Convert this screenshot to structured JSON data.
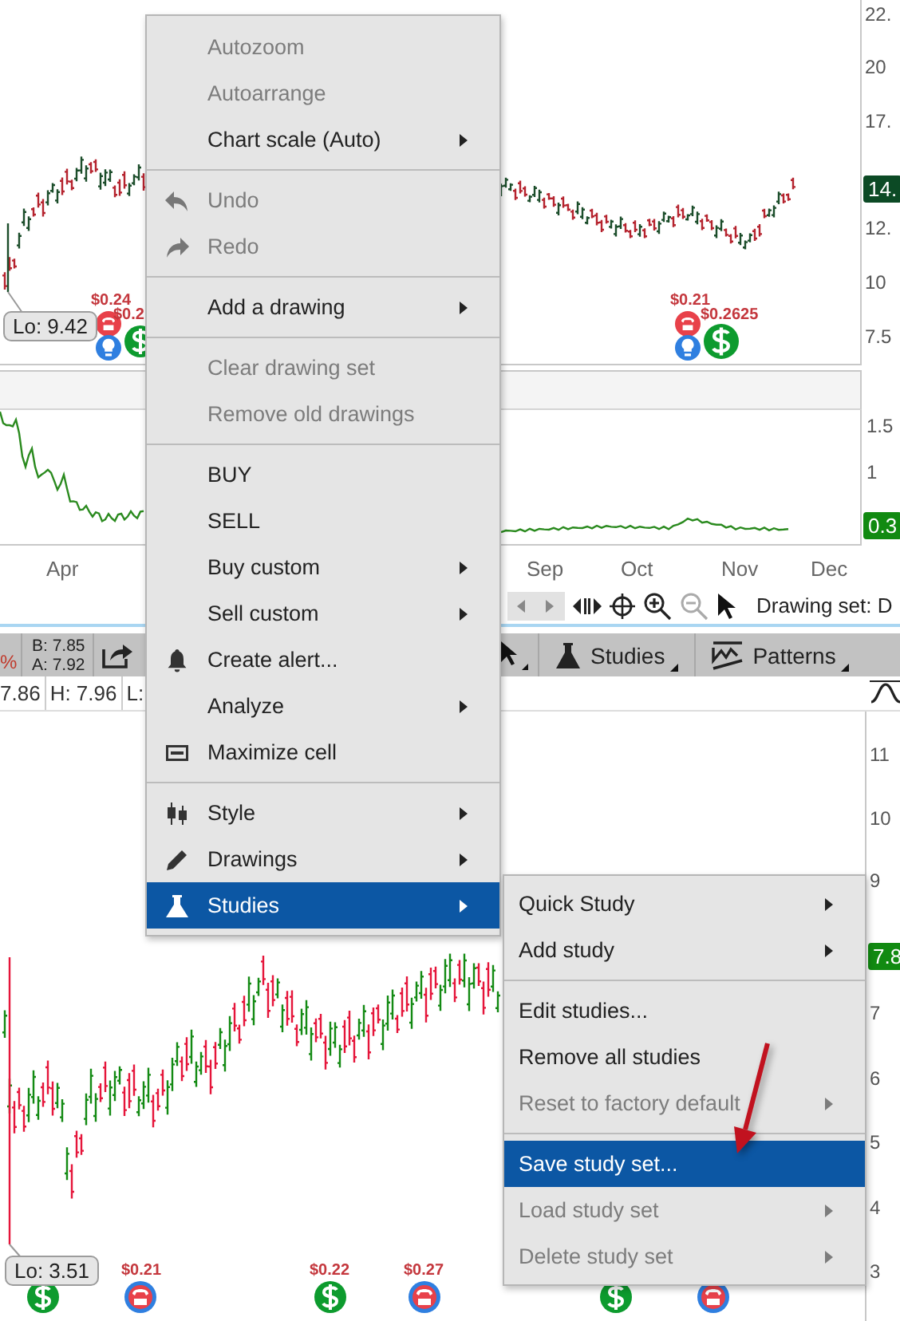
{
  "price_chart": {
    "axis_labels": [
      "22.",
      "20",
      "17.",
      "12.",
      "10",
      "7.5"
    ],
    "last_price": "14.",
    "low_label": "Lo: 9.42",
    "dividends": [
      "$0.24",
      "$0.2",
      "$0.21",
      "$0.2625"
    ]
  },
  "study_pane": {
    "axis_labels": [
      "1.5",
      "1"
    ],
    "last_value": "0.3"
  },
  "time_axis": [
    "Apr",
    "Sep",
    "Oct",
    "Nov",
    "Dec"
  ],
  "chart_toolbar": {
    "drawing_set": "Drawing set: D"
  },
  "cell_toolbar": {
    "change": "%",
    "bid": "B: 7.85",
    "ask": "A: 7.92",
    "buttons": [
      "Studies",
      "Patterns"
    ]
  },
  "quote_row": [
    "7.86",
    "H: 7.96",
    "L:"
  ],
  "lower_chart": {
    "axis_labels": [
      "11",
      "10",
      "9",
      "7",
      "6",
      "5",
      "4",
      "3"
    ],
    "last_price": "7.8",
    "low_label": "Lo: 3.51",
    "dividends": [
      "$0.21",
      "$0.22",
      "$0.27"
    ]
  },
  "context_menu": [
    {
      "kind": "item",
      "label": "Autozoom",
      "disabled": true,
      "selected": false,
      "submenu": false
    },
    {
      "kind": "item",
      "label": "Autoarrange",
      "disabled": true,
      "selected": false,
      "submenu": false
    },
    {
      "kind": "item",
      "label": "Chart scale (Auto)",
      "disabled": false,
      "selected": false,
      "submenu": true
    },
    {
      "kind": "separator"
    },
    {
      "kind": "item",
      "label": "Undo",
      "disabled": true,
      "selected": false,
      "submenu": false
    },
    {
      "kind": "item",
      "label": "Redo",
      "disabled": true,
      "selected": false,
      "submenu": false
    },
    {
      "kind": "separator"
    },
    {
      "kind": "item",
      "label": "Add a drawing",
      "disabled": false,
      "selected": false,
      "submenu": true
    },
    {
      "kind": "separator"
    },
    {
      "kind": "item",
      "label": "Clear drawing set",
      "disabled": true,
      "selected": false,
      "submenu": false
    },
    {
      "kind": "item",
      "label": "Remove old drawings",
      "disabled": true,
      "selected": false,
      "submenu": false
    },
    {
      "kind": "separator"
    },
    {
      "kind": "item",
      "label": "BUY",
      "disabled": false,
      "selected": false,
      "submenu": false
    },
    {
      "kind": "item",
      "label": "SELL",
      "disabled": false,
      "selected": false,
      "submenu": false
    },
    {
      "kind": "item",
      "label": "Buy custom",
      "disabled": false,
      "selected": false,
      "submenu": true
    },
    {
      "kind": "item",
      "label": "Sell custom",
      "disabled": false,
      "selected": false,
      "submenu": true
    },
    {
      "kind": "item",
      "label": "Create alert...",
      "disabled": false,
      "selected": false,
      "submenu": false
    },
    {
      "kind": "item",
      "label": "Analyze",
      "disabled": false,
      "selected": false,
      "submenu": true
    },
    {
      "kind": "item",
      "label": "Maximize cell",
      "disabled": false,
      "selected": false,
      "submenu": false
    },
    {
      "kind": "separator"
    },
    {
      "kind": "item",
      "label": "Style",
      "disabled": false,
      "selected": false,
      "submenu": true
    },
    {
      "kind": "item",
      "label": "Drawings",
      "disabled": false,
      "selected": false,
      "submenu": true
    },
    {
      "kind": "item",
      "label": "Studies",
      "disabled": false,
      "selected": true,
      "submenu": true
    }
  ],
  "studies_submenu": [
    {
      "kind": "item",
      "label": "Quick Study",
      "disabled": false,
      "selected": false,
      "submenu": true
    },
    {
      "kind": "item",
      "label": "Add study",
      "disabled": false,
      "selected": false,
      "submenu": true
    },
    {
      "kind": "separator"
    },
    {
      "kind": "item",
      "label": "Edit studies...",
      "disabled": false,
      "selected": false,
      "submenu": false
    },
    {
      "kind": "item",
      "label": "Remove all studies",
      "disabled": false,
      "selected": false,
      "submenu": false
    },
    {
      "kind": "item",
      "label": "Reset to factory default",
      "disabled": true,
      "selected": false,
      "submenu": true
    },
    {
      "kind": "separator"
    },
    {
      "kind": "item",
      "label": "Save study set...",
      "disabled": false,
      "selected": true,
      "submenu": false
    },
    {
      "kind": "item",
      "label": "Load study set",
      "disabled": true,
      "selected": false,
      "submenu": true
    },
    {
      "kind": "item",
      "label": "Delete study set",
      "disabled": true,
      "selected": false,
      "submenu": true
    }
  ]
}
